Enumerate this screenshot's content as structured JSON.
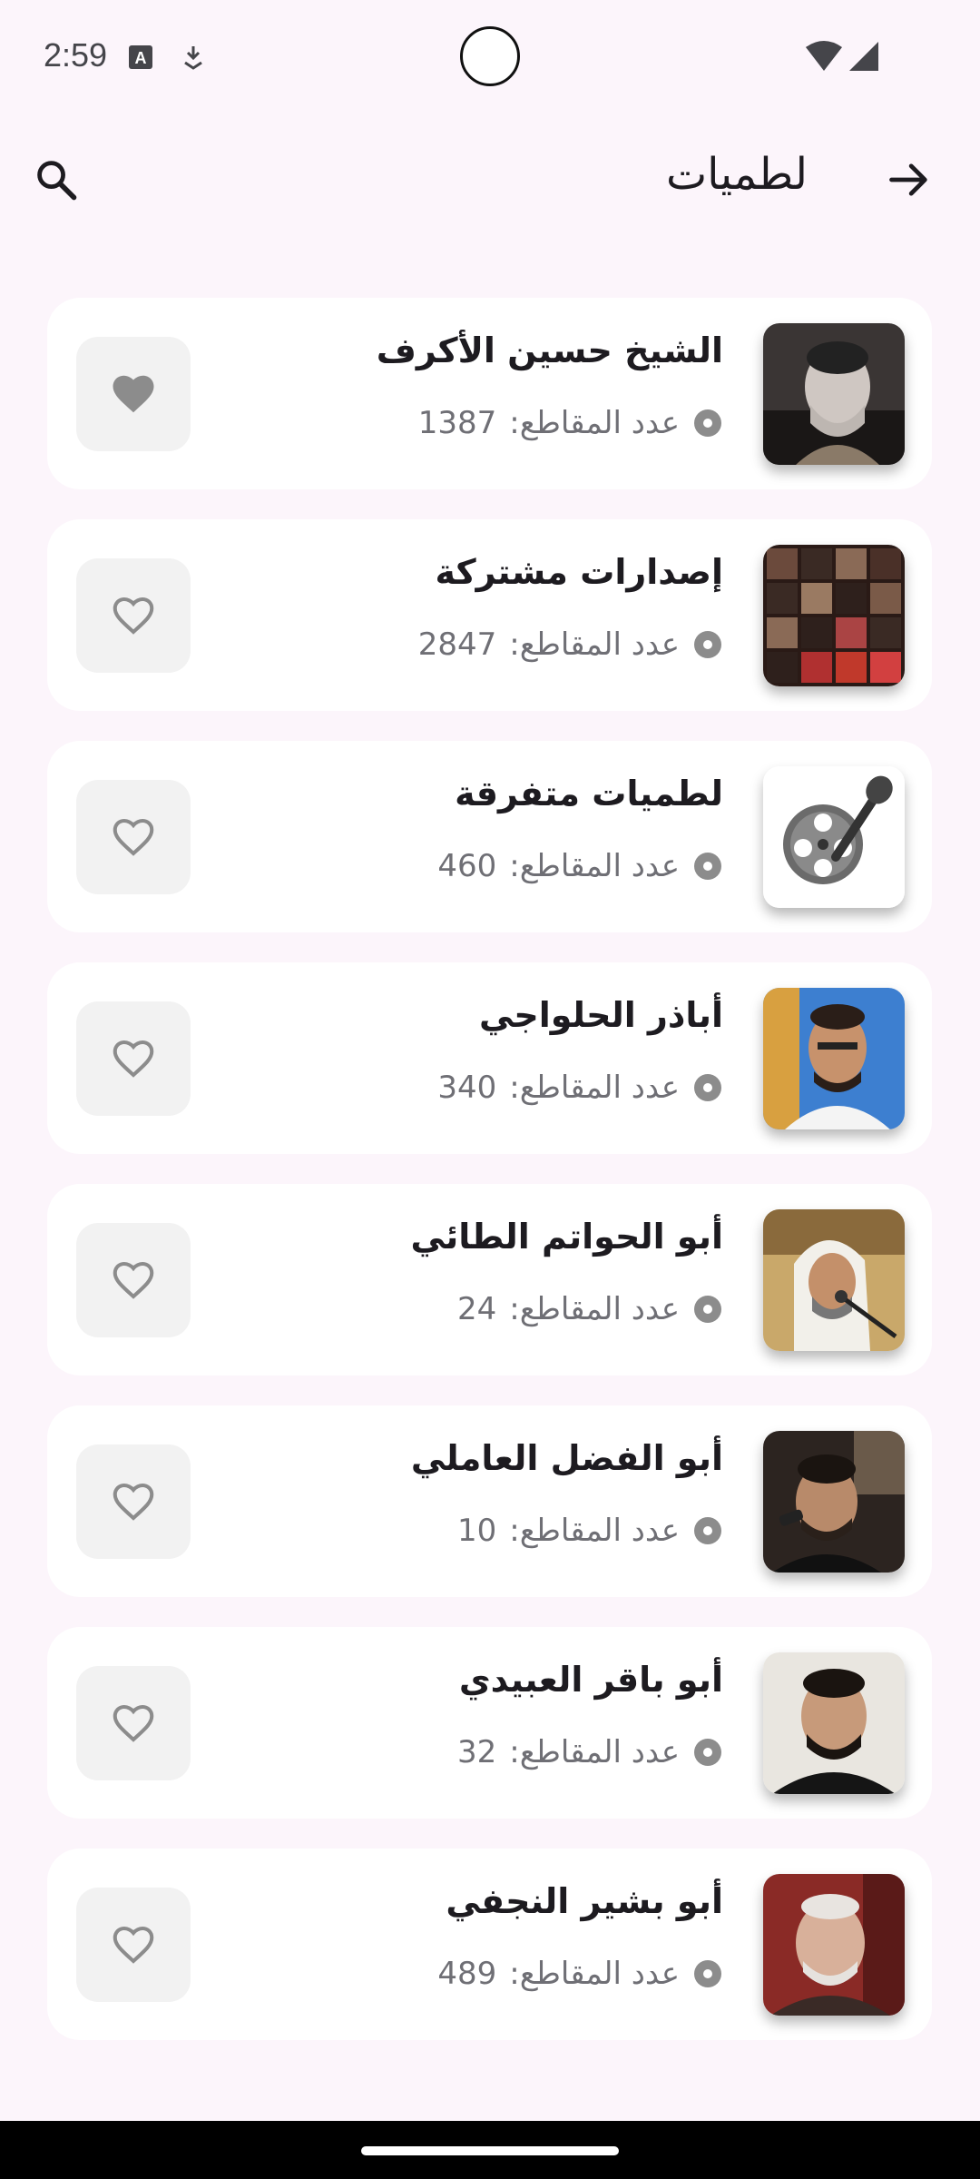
{
  "status_bar": {
    "time": "2:59"
  },
  "app_bar": {
    "title": "لطميات",
    "search_icon": "search-icon",
    "back_icon": "arrow-forward-icon"
  },
  "meta_label": "عدد المقاطع:",
  "items": [
    {
      "title": "الشيخ حسين الأكرف",
      "count": "1387",
      "favorite": true
    },
    {
      "title": "إصدارات مشتركة",
      "count": "2847",
      "favorite": false
    },
    {
      "title": "لطميات متفرقة",
      "count": "460",
      "favorite": false
    },
    {
      "title": "أباذر الحلواجي",
      "count": "340",
      "favorite": false
    },
    {
      "title": "أبو الحواتم الطائي",
      "count": "24",
      "favorite": false
    },
    {
      "title": "أبو الفضل العاملي",
      "count": "10",
      "favorite": false
    },
    {
      "title": "أبو باقر العبيدي",
      "count": "32",
      "favorite": false
    },
    {
      "title": "أبو بشير النجفي",
      "count": "489",
      "favorite": false
    }
  ],
  "colors": {
    "background": "#FCF5FB",
    "card": "#FFFFFF",
    "favorite_bg": "#F2F2F2",
    "heart": "#8C8C8C"
  }
}
